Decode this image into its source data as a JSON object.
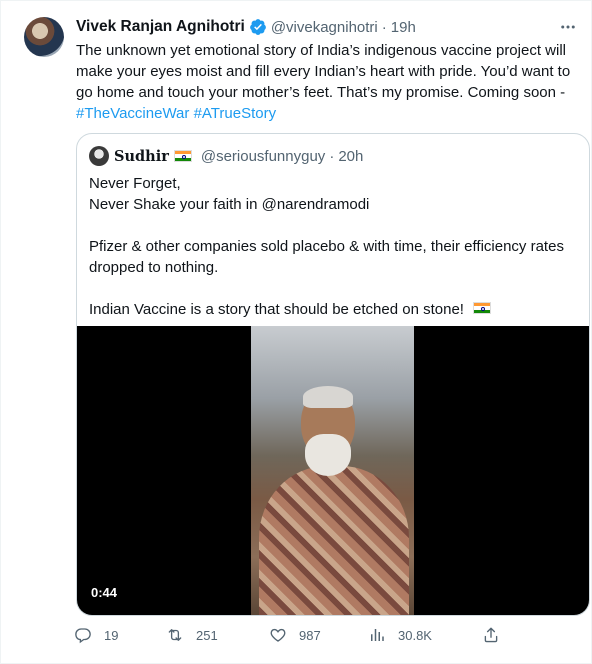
{
  "author": {
    "name": "Vivek Ranjan Agnihotri",
    "handle": "@vivekagnihotri",
    "separator": "·",
    "time": "19h"
  },
  "tweet": {
    "text": "The unknown yet emotional story of India’s indigenous vaccine project will make your eyes moist and fill every Indian’s heart with pride. You’d want to go home and touch your mother’s feet. That’s my promise. Coming soon - ",
    "hashtag_1": "#TheVaccineWar",
    "hashtag_2": "#ATrueStory"
  },
  "quote": {
    "name": "Sudhir",
    "handle": "@seriousfunnyguy",
    "separator": "·",
    "time": "20h",
    "line_1": "Never Forget,",
    "line_2": "Never Shake your faith in @narendramodi",
    "line_3": "Pfizer & other companies sold placebo & with time, their efficiency rates dropped to nothing.",
    "line_4": "Indian Vaccine is a story that should be etched on stone!",
    "video_duration": "0:44"
  },
  "actions": {
    "replies": "19",
    "retweets": "251",
    "likes": "987",
    "views": "30.8K"
  },
  "colors": {
    "accent": "#1d9bf0",
    "muted": "#536471",
    "text": "#0f1419",
    "border": "#cfd9de"
  },
  "icons": [
    "verified-badge-icon",
    "more-icon",
    "reply-icon",
    "retweet-icon",
    "like-icon",
    "views-icon",
    "share-icon",
    "india-flag-icon"
  ]
}
